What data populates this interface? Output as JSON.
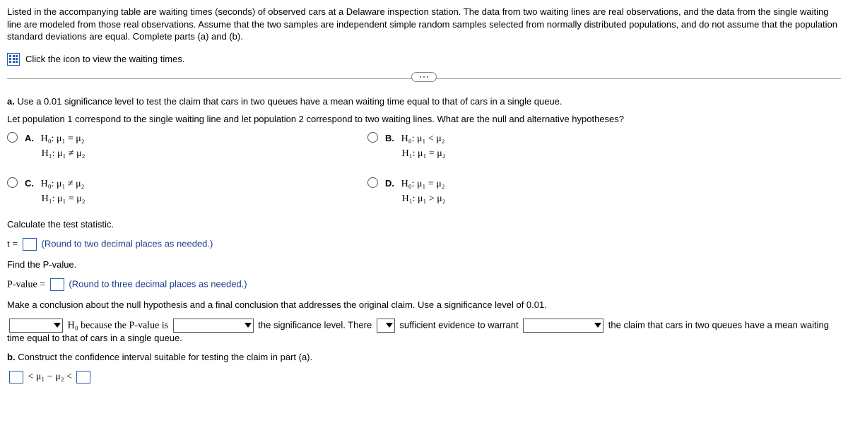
{
  "intro": "Listed in the accompanying table are waiting times (seconds) of observed cars at a Delaware inspection station. The data from two waiting lines are real observations, and the data from the single waiting line are modeled from those real observations. Assume that the two samples are independent simple random samples selected from normally distributed populations, and do not assume that the population standard deviations are equal. Complete parts (a) and (b).",
  "click_icon_text": "Click the icon to view the waiting times.",
  "part_a_lead": "a.",
  "part_a_text": "Use a 0.01 significance level to test the claim that cars in two queues have a mean waiting time equal to that of cars in a single queue.",
  "part_a_sub": "Let population 1 correspond to the single waiting line and let population 2 correspond to two waiting lines. What are the null and alternative hypotheses?",
  "options": {
    "A": {
      "label": "A.",
      "h0": "H₀: μ₁ = μ₂",
      "h1": "H₁: μ₁ ≠ μ₂"
    },
    "B": {
      "label": "B.",
      "h0": "H₀: μ₁ < μ₂",
      "h1": "H₁: μ₁ = μ₂"
    },
    "C": {
      "label": "C.",
      "h0": "H₀: μ₁ ≠ μ₂",
      "h1": "H₁: μ₁ = μ₂"
    },
    "D": {
      "label": "D.",
      "h0": "H₀: μ₁ = μ₂",
      "h1": "H₁: μ₁ > μ₂"
    }
  },
  "calc_stat_label": "Calculate the test statistic.",
  "t_prefix": "t =",
  "t_hint": "(Round to two decimal places as needed.)",
  "find_p_label": "Find the P-value.",
  "p_prefix": "P-value =",
  "p_hint": "(Round to three decimal places as needed.)",
  "conclusion_prompt": "Make a conclusion about the null hypothesis and a final conclusion that addresses the original claim. Use a significance level of 0.01.",
  "concl": {
    "h0_segment": " H₀ because the P-value is ",
    "sig_segment": " the significance level. There ",
    "suff_segment": " sufficient evidence to warrant ",
    "tail": " the claim that cars in two queues have a mean waiting time equal to that of cars in a single queue."
  },
  "part_b_lead": "b.",
  "part_b_text": "Construct the confidence interval suitable for testing the claim in part (a).",
  "ci": {
    "lt1": "<",
    "mid": "μ₁ − μ₂",
    "lt2": "<"
  }
}
